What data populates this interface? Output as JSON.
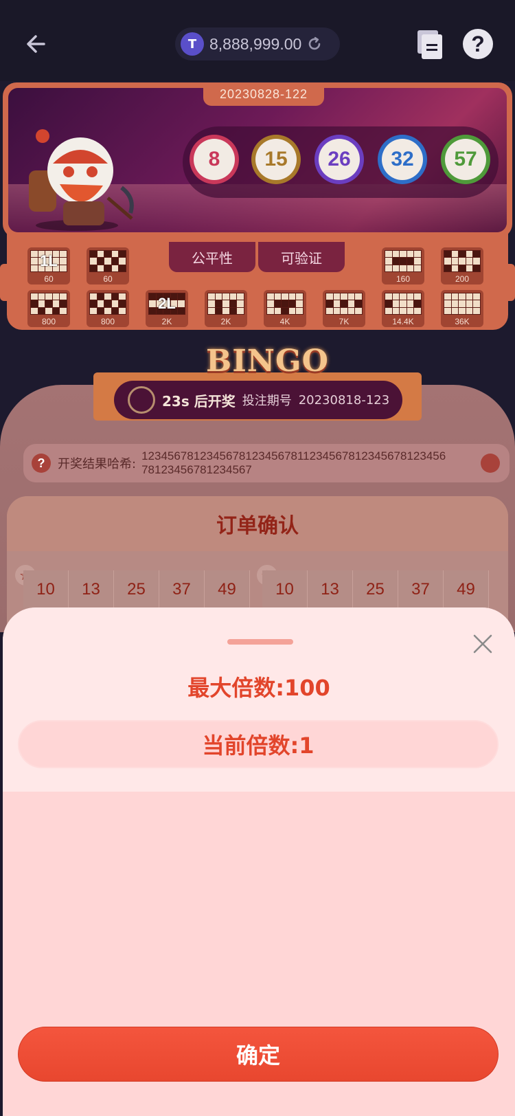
{
  "header": {
    "balance": "8,888,999.00",
    "coin_symbol": "T"
  },
  "draw": {
    "issue": "20230828-122",
    "balls": [
      {
        "number": "8",
        "color": "#c9385a"
      },
      {
        "number": "15",
        "color": "#a8792a"
      },
      {
        "number": "26",
        "color": "#6b3ec0"
      },
      {
        "number": "32",
        "color": "#2e6ec8"
      },
      {
        "number": "57",
        "color": "#4f9a3a"
      }
    ]
  },
  "patterns": {
    "row1": [
      {
        "label": "1L",
        "value": "60"
      },
      {
        "label": "",
        "value": "60"
      },
      {
        "label": "",
        "value": "160"
      },
      {
        "label": "",
        "value": "200"
      }
    ],
    "row2": [
      {
        "label": "",
        "value": "800"
      },
      {
        "label": "",
        "value": "800"
      },
      {
        "label": "2L",
        "value": "2K"
      },
      {
        "label": "",
        "value": "2K"
      },
      {
        "label": "",
        "value": "4K"
      },
      {
        "label": "",
        "value": "7K"
      },
      {
        "label": "",
        "value": "14.4K"
      },
      {
        "label": "",
        "value": "36K"
      }
    ],
    "tabs": [
      "公平性",
      "可验证"
    ]
  },
  "bingo": {
    "title": "BINGO",
    "countdown": "23s 后开奖",
    "next_issue_label": "投注期号",
    "next_issue": "20230818-123",
    "hash_label": "开奖结果哈希:",
    "hash_value": "1234567812345678123456781123456781234567812345678123456781234567"
  },
  "order": {
    "title": "订单确认",
    "ticket_a": [
      "10",
      "13",
      "25",
      "37",
      "49"
    ],
    "ticket_b": [
      "10",
      "13",
      "25",
      "37",
      "49"
    ]
  },
  "sheet": {
    "max_multiplier": "最大倍数:100",
    "current_multiplier": "当前倍数:1",
    "confirm_label": "确定"
  }
}
